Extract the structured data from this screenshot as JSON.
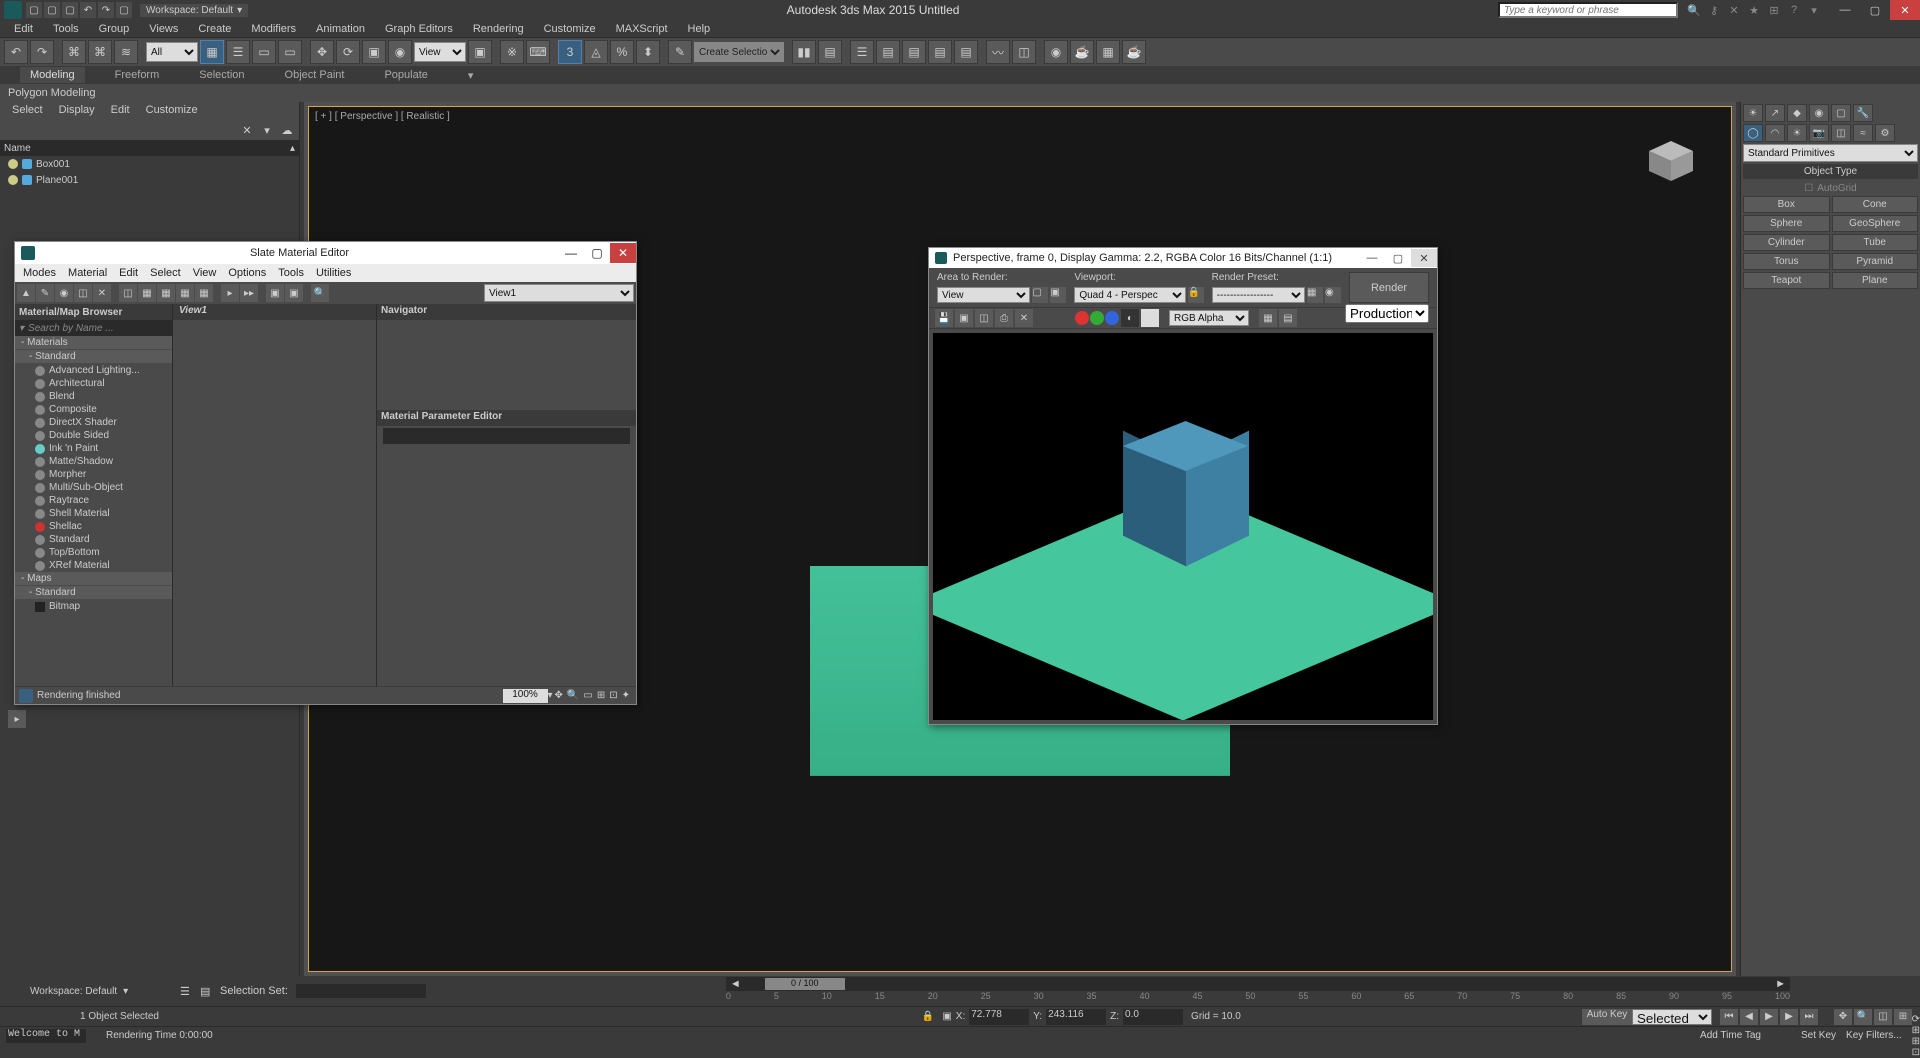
{
  "app": {
    "title": "Autodesk 3ds Max  2015      Untitled",
    "workspace_label": "Workspace: Default",
    "search_placeholder": "Type a keyword or phrase"
  },
  "menubar": [
    "Edit",
    "Tools",
    "Group",
    "Views",
    "Create",
    "Modifiers",
    "Animation",
    "Graph Editors",
    "Rendering",
    "Customize",
    "MAXScript",
    "Help"
  ],
  "toolbar": {
    "named_sel_set": "All",
    "ref_coord": "View",
    "create_sel_set": "Create Selection Se"
  },
  "ribbon": {
    "tabs": [
      "Modeling",
      "Freeform",
      "Selection",
      "Object Paint",
      "Populate"
    ],
    "sub": "Polygon Modeling"
  },
  "scene_explorer": {
    "menus": [
      "Select",
      "Display",
      "Edit",
      "Customize"
    ],
    "header": "Name",
    "items": [
      "Box001",
      "Plane001"
    ]
  },
  "viewport": {
    "label": "[ + ] [ Perspective ] [ Realistic ]"
  },
  "command_panel": {
    "dropdown": "Standard Primitives",
    "section": "Object Type",
    "autogrid": "AutoGrid",
    "buttons": [
      "Box",
      "Cone",
      "Sphere",
      "GeoSphere",
      "Cylinder",
      "Tube",
      "Torus",
      "Pyramid",
      "Teapot",
      "Plane"
    ]
  },
  "timeline": {
    "workspace": "Workspace: Default",
    "selection_set_label": "Selection Set:",
    "scrub": "0 / 100",
    "ticks": [
      "0",
      "5",
      "10",
      "15",
      "20",
      "25",
      "30",
      "35",
      "40",
      "45",
      "50",
      "55",
      "60",
      "65",
      "70",
      "75",
      "80",
      "85",
      "90",
      "95",
      "100"
    ]
  },
  "status": {
    "selected": "1 Object Selected",
    "x_label": "X:",
    "x": "72.778",
    "y_label": "Y:",
    "y": "243.116",
    "z_label": "Z:",
    "z": "0.0",
    "grid": "Grid = 10.0",
    "add_time_tag": "Add Time Tag",
    "autokey": "Auto Key",
    "setkey": "Set Key",
    "selected_mode": "Selected",
    "key_filters": "Key Filters...",
    "welcome": "Welcome to M",
    "render_time": "Rendering Time  0:00:00",
    "render_finished": "Rendering finished"
  },
  "slate": {
    "title": "Slate Material Editor",
    "menus": [
      "Modes",
      "Material",
      "Edit",
      "Select",
      "View",
      "Options",
      "Tools",
      "Utilities"
    ],
    "view_dd": "View1",
    "browser_hdr": "Material/Map Browser",
    "search_placeholder": "Search by Name ...",
    "tree_materials": "- Materials",
    "tree_standard": "- Standard",
    "materials": [
      "Advanced Lighting...",
      "Architectural",
      "Blend",
      "Composite",
      "DirectX Shader",
      "Double Sided",
      "Ink 'n Paint",
      "Matte/Shadow",
      "Morpher",
      "Multi/Sub-Object",
      "Raytrace",
      "Shell Material",
      "Shellac",
      "Standard",
      "Top/Bottom",
      "XRef Material"
    ],
    "tree_maps": "- Maps",
    "tree_maps_std": "- Standard",
    "maps": [
      "Bitmap"
    ],
    "canvas_hdr": "View1",
    "navigator": "Navigator",
    "param_editor": "Material Parameter Editor",
    "zoom": "100%"
  },
  "render": {
    "title": "Perspective, frame 0, Display Gamma: 2.2, RGBA Color 16 Bits/Channel (1:1)",
    "area_label": "Area to Render:",
    "area": "View",
    "viewport_label": "Viewport:",
    "viewport": "Quad 4 - Perspec",
    "preset_label": "Render Preset:",
    "preset": "-----------------",
    "render_btn": "Render",
    "production": "Production",
    "channel": "RGB Alpha"
  }
}
